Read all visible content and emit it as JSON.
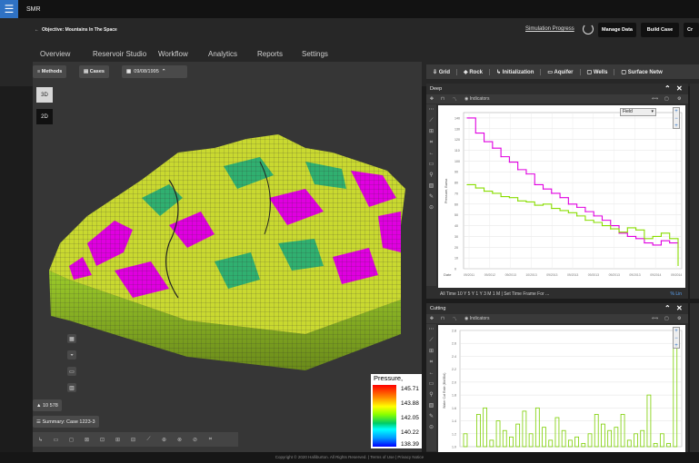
{
  "app": {
    "title": "SMR",
    "menu_icon": "hamburger-icon"
  },
  "header": {
    "breadcrumb": "Objective: Mountains In The Space",
    "simulation_progress": "Simulation Progress",
    "buttons": {
      "manage_data": "Manage Data",
      "build_case": "Build Case",
      "cr": "Cr"
    }
  },
  "nav": {
    "tabs": [
      "Overview",
      "Reservoir Studio",
      "Workflow",
      "Analytics",
      "Reports",
      "Settings"
    ]
  },
  "left_toolbar": {
    "methods": "Methods",
    "cases": "Cases",
    "date": "09/08/1995"
  },
  "view_toggle": {
    "three_d": "3D",
    "two_d": "2D"
  },
  "counter": "10 578",
  "summary": "Summary: Case 1223-3",
  "legend": {
    "title": "Pressure, Barsa",
    "values": [
      "145.71",
      "143.88",
      "142.05",
      "140.22",
      "138.39"
    ]
  },
  "right_toolbar": [
    "Grid",
    "Rock",
    "Initialization",
    "Aquifer",
    "Wells",
    "Surface Netw"
  ],
  "top_chart": {
    "title": "Deep",
    "tool_label": "Indicators",
    "dropdown": "Field",
    "ylabel": "Pressure, Barsa",
    "xlabel": "Date",
    "time_bar": "All Time  10 Y  5 Y  1 Y  3 M  1 M  |  Set Time Frame For ...",
    "time_bar_right": "%  Lin"
  },
  "bottom_chart": {
    "title": "Cutting",
    "tool_label": "Indicators",
    "ylabel": "Water Cut Rate (Bbl/Bbl)"
  },
  "footer": "Copyright © 2020 Halliburton. All Rights Reserved. | Terms of Use | Privacy Notice",
  "colors": {
    "accent": "#2f72c4",
    "magenta": "#e000e0",
    "green": "#88dd00"
  },
  "chart_data": [
    {
      "type": "line",
      "title": "Deep",
      "ylabel": "Pressure, Barsa",
      "ylim": [
        0,
        145
      ],
      "x_ticks": [
        "09/2011",
        "09/2012",
        "09/2013",
        "10/2013",
        "09/2013",
        "09/2013",
        "09/2013",
        "09/2013",
        "09/2013",
        "09/2014",
        "09/2014"
      ],
      "y_ticks": [
        0,
        10,
        20,
        30,
        40,
        50,
        60,
        70,
        80,
        90,
        100,
        110,
        120,
        130,
        140
      ],
      "series": [
        {
          "name": "",
          "color": "#e000e0",
          "values": [
            140,
            126,
            118,
            112,
            104,
            99,
            92,
            88,
            78,
            74,
            70,
            66,
            60,
            57,
            53,
            49,
            45,
            40,
            33,
            30,
            28,
            24,
            22,
            26,
            24,
            20
          ]
        },
        {
          "name": "",
          "color": "#88dd00",
          "values": [
            78,
            75,
            72,
            70,
            67,
            66,
            63,
            62,
            59,
            60,
            56,
            54,
            52,
            49,
            45,
            43,
            40,
            37,
            34,
            38,
            36,
            28,
            30,
            33,
            28,
            3
          ]
        }
      ]
    },
    {
      "type": "bar",
      "title": "Cutting",
      "ylabel": "Water Cut Rate (Bbl/Bbl)",
      "ylim": [
        1.0,
        2.8
      ],
      "y_ticks": [
        1.0,
        1.2,
        1.4,
        1.6,
        1.8,
        2.0,
        2.2,
        2.4,
        2.6,
        2.8
      ],
      "values": [
        1.2,
        1.0,
        1.5,
        1.6,
        1.1,
        1.4,
        1.25,
        1.15,
        1.35,
        1.55,
        1.2,
        1.6,
        1.3,
        1.1,
        1.45,
        1.25,
        1.1,
        1.15,
        1.05,
        1.2,
        1.5,
        1.35,
        1.25,
        1.3,
        1.5,
        1.1,
        1.2,
        1.25,
        1.8,
        1.05,
        1.2,
        1.05,
        2.6
      ]
    }
  ]
}
